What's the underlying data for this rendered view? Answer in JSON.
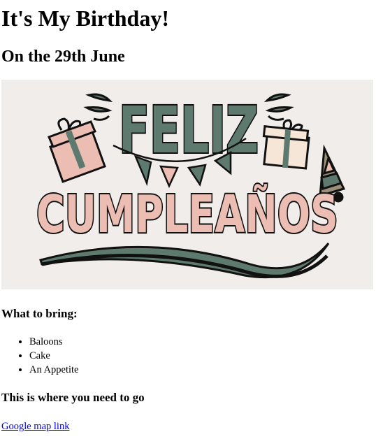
{
  "page": {
    "title": "It's My Birthday!",
    "subtitle": "On the 29th June"
  },
  "banner": {
    "text_top": "FELIZ",
    "text_bottom": "CUMPLEAÑOS",
    "colors": {
      "background": "#f1edeb",
      "green": "#5e7a6e",
      "pink": "#ecbdb2",
      "cream": "#f6e6d8",
      "outline": "#111111"
    }
  },
  "bring": {
    "heading": "What to bring:",
    "items": [
      "Baloons",
      "Cake",
      "An Appetite"
    ]
  },
  "location": {
    "heading": "This is where you need to go",
    "link_text": "Google map link"
  }
}
